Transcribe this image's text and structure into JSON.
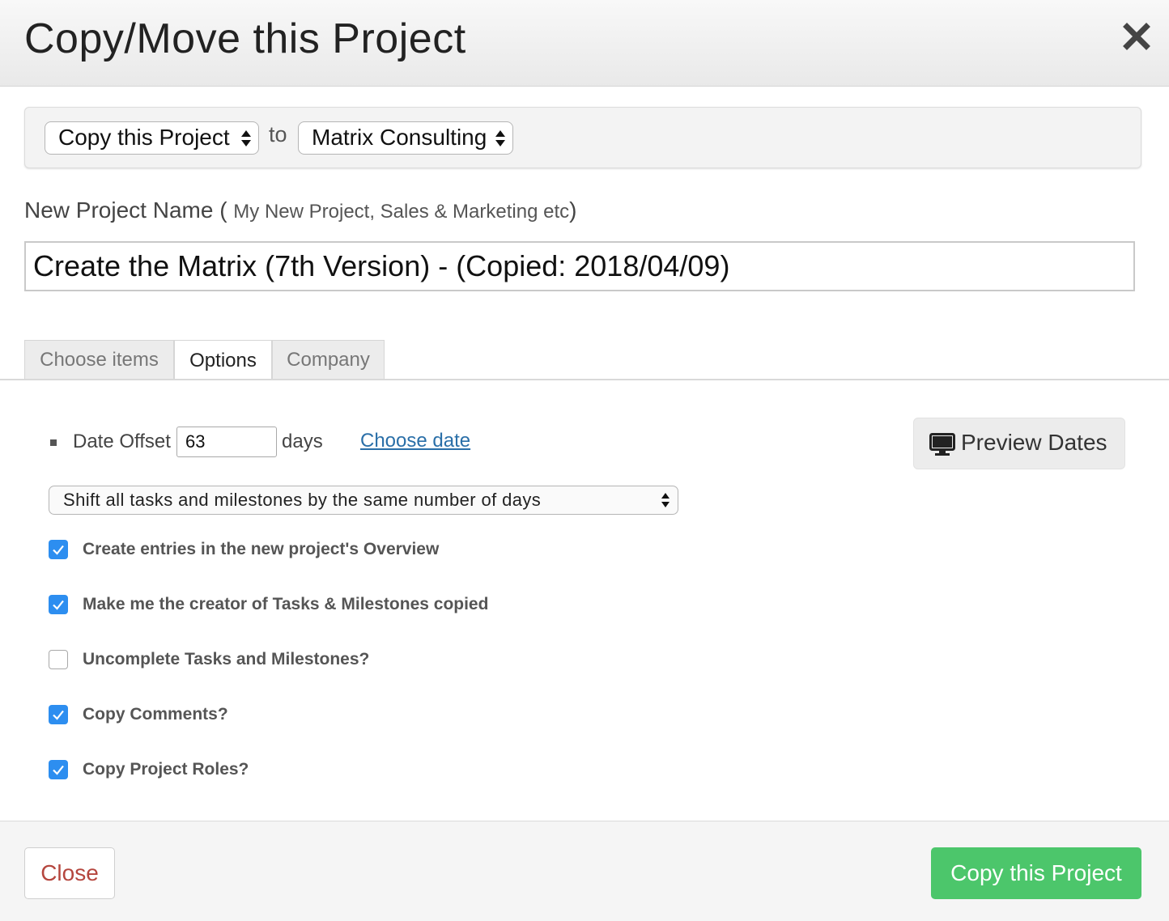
{
  "dialog": {
    "title": "Copy/Move this Project"
  },
  "copy_bar": {
    "action_value": "Copy this Project",
    "to_label": "to",
    "target_value": "Matrix Consulting"
  },
  "project_name": {
    "label": "New Project Name",
    "hint_open": "(",
    "hint": "My New Project, Sales & Marketing etc",
    "hint_close": ")",
    "value": "Create the Matrix (7th Version) - (Copied: 2018/04/09)"
  },
  "tabs": [
    {
      "label": "Choose items",
      "active": false
    },
    {
      "label": "Options",
      "active": true
    },
    {
      "label": "Company",
      "active": false
    }
  ],
  "options": {
    "date_offset_label": "Date Offset",
    "date_offset_value": "63",
    "days_label": "days",
    "choose_date_link": "Choose date",
    "preview_button": "Preview Dates",
    "shift_select_value": "Shift all tasks and milestones by the same number of days",
    "checkboxes": [
      {
        "label": "Create entries in the new project's Overview",
        "checked": true
      },
      {
        "label": "Make me the creator of Tasks & Milestones copied",
        "checked": true
      },
      {
        "label": "Uncomplete Tasks and Milestones?",
        "checked": false
      },
      {
        "label": "Copy Comments?",
        "checked": true
      },
      {
        "label": "Copy Project Roles?",
        "checked": true
      }
    ]
  },
  "footer": {
    "close_button": "Close",
    "copy_button": "Copy this Project"
  },
  "colors": {
    "accent_checkbox": "#2d8ef0",
    "primary_button": "#4cc66b",
    "close_text": "#b5463e",
    "link": "#2a6fa8"
  }
}
